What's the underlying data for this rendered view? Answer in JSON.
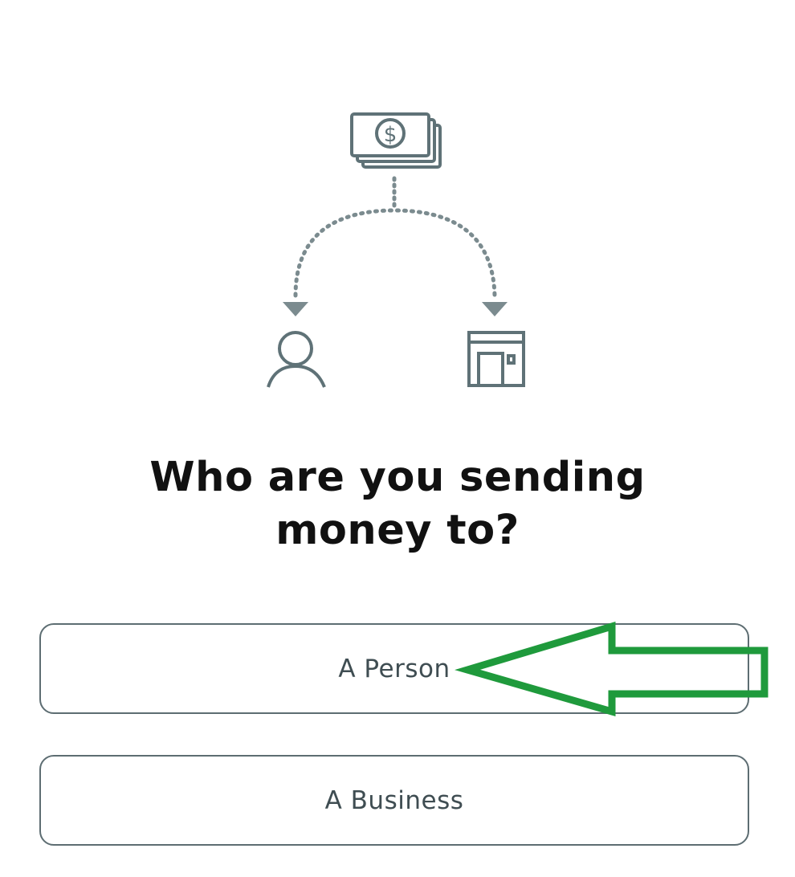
{
  "prompt": {
    "line1": "Who are you sending",
    "line2": "money to?"
  },
  "options": [
    {
      "label": "A Person"
    },
    {
      "label": "A Business"
    }
  ],
  "illustration": {
    "icons": [
      "money-stack-icon",
      "person-icon",
      "storefront-icon"
    ],
    "dollar_symbol": "$"
  },
  "colors": {
    "icon_stroke": "#5f7277",
    "button_border": "#5d6d72",
    "annotation_arrow": "#1f9a3c",
    "title": "#111111"
  }
}
